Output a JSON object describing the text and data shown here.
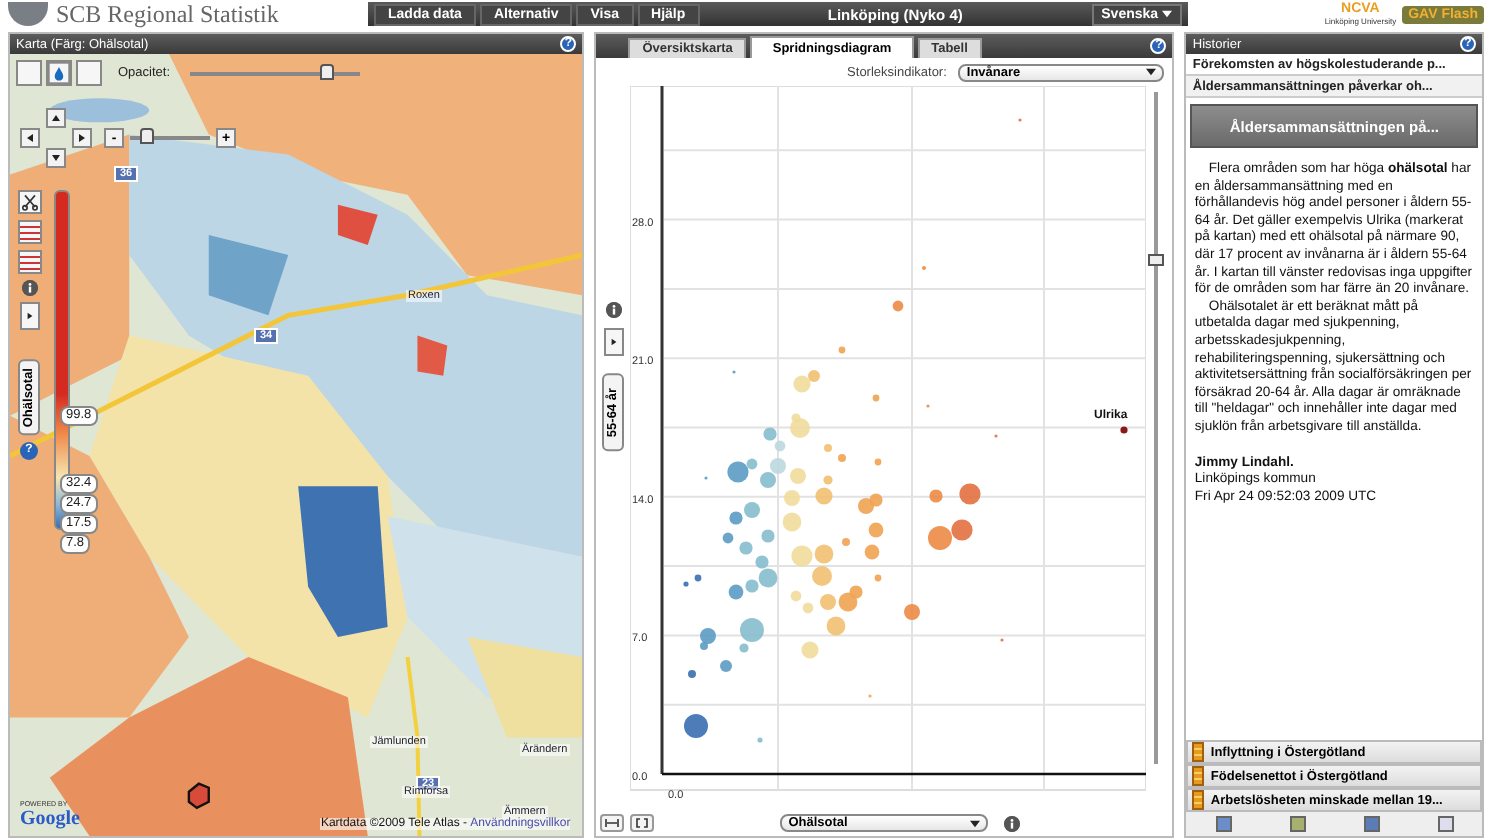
{
  "help_symbol": "?",
  "header": {
    "logo_text": "SCB Regional Statistik",
    "menu": [
      "Ladda data",
      "Alternativ",
      "Visa",
      "Hjälp"
    ],
    "title": "Linköping (Nyko 4)",
    "language": "Svenska",
    "partner_logo": "NCVA",
    "partner_caption": "Linköping University",
    "badge": "GAV Flash"
  },
  "map_panel": {
    "title": "Karta (Färg: Ohälsotal)",
    "opacity_label": "Opacitet:",
    "opacity_slider": {
      "level": 0.8
    },
    "zoom_out": "-",
    "zoom_in": "+",
    "zoom_slider": {
      "level": 0.2
    },
    "legend": {
      "title": "Ohälsotal",
      "values": [
        "99.8",
        "32.4",
        "24.7",
        "17.5",
        "7.8"
      ]
    },
    "place_labels": [
      "Roxen",
      "Jämlunden",
      "Rimforsa",
      "Ärändern",
      "Ämmern"
    ],
    "road_signs": [
      "36",
      "34",
      "23"
    ],
    "attribution": "Kartdata ©2009 Tele Atlas - ",
    "terms_link": "Användningsvillkor",
    "powered_by": "POWERED BY",
    "provider": "Google"
  },
  "chart_panel": {
    "tabs": [
      {
        "label": "Översiktskarta",
        "selected": false
      },
      {
        "label": "Spridningsdiagram",
        "selected": true
      },
      {
        "label": "Tabell",
        "selected": false
      }
    ],
    "size_label": "Storleksindikator:",
    "size_select": "Invånare",
    "y_ticks": [
      "28.0",
      "21.0",
      "14.0",
      "7.0",
      "0.0"
    ],
    "x_tick": "0.0",
    "y_axis_select": "55-64 år",
    "x_axis_select": "Ohälsotal",
    "highlight_label": "Ulrika",
    "y_range_slider": {
      "level": 0.75
    }
  },
  "story_panel": {
    "title": "Historier",
    "stories": [
      {
        "title": "Förekomsten av högskolestuderande p...",
        "selected": false
      },
      {
        "title": "Åldersammansättningen påverkar oh...",
        "selected": true
      }
    ],
    "active_title": "Åldersammansättningen på...",
    "paragraphs": [
      "Flera områden som har höga **ohälsotal** har en åldersammansättning med en förhållandevis hög andel personer i åldern 55-64 år. Det gäller exempelvis Ulrika (markerat på kartan) med ett ohälsotal på närmare 90, där 17 procent av invånarna är i åldern 55-64 år. I kartan till vänster redovisas inga uppgifter för de områden som har färre än 20 invånare.",
      "Ohälsotalet är ett beräknat mått på utbetalda dagar med sjukpenning, arbetsskadesjukpenning, rehabiliteringspenning, sjukersättning och aktivitetsersättning från socialförsäkringen per försäkrad 20-64 år. Alla dagar är omräknade till \"heldagar\" och innehåller inte dagar med sjuklön från arbetsgivare till anställda."
    ],
    "author": "Jimmy Lindahl.",
    "organization": "Linköpings kommun",
    "date": "Fri Apr 24 09:52:03 2009 UTC",
    "more_stories": [
      "Inflyttning i Östergötland",
      "Födelsenettot i Östergötland",
      "Arbetslösheten minskade mellan 19..."
    ]
  }
}
